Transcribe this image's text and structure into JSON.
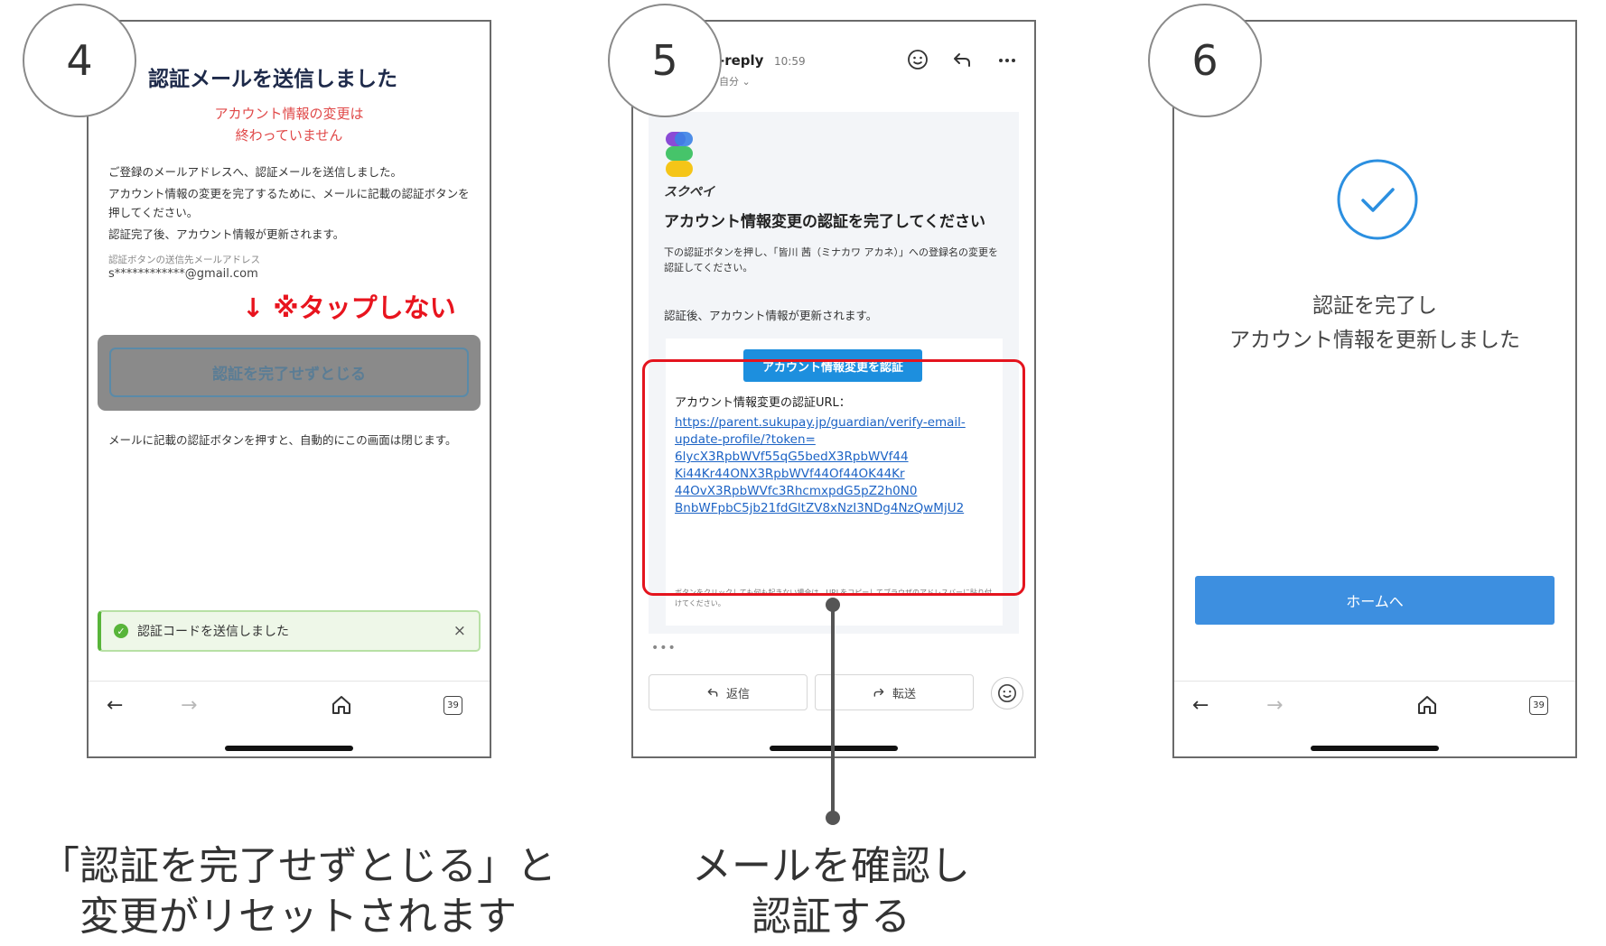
{
  "steps": {
    "s4": "4",
    "s5": "5",
    "s6": "6"
  },
  "screen4": {
    "title": "認証メールを送信しました",
    "warning_line1": "アカウント情報の変更は",
    "warning_line2": "終わっていません",
    "body_p1": "ご登録のメールアドレスへ、認証メールを送信しました。",
    "body_p2": "アカウント情報の変更を完了するために、メールに記載の認証ボタンを押してください。",
    "body_p3": "認証完了後、アカウント情報が更新されます。",
    "email_label": "認証ボタンの送信先メールアドレス",
    "email": "s************@gmail.com",
    "dont_tap": "↓ ※タップしない",
    "close_button": "認証を完了せずとじる",
    "note": "メールに記載の認証ボタンを押すと、自動的にこの画面は閉じます。",
    "toast_text": "認証コードを送信しました",
    "toast_close": "×",
    "tab_count": "39"
  },
  "screen5": {
    "sender": "-reply",
    "time": "10:59",
    "me": "自分 ⌄",
    "brand": "スクペイ",
    "heading": "アカウント情報変更の認証を完了してください",
    "description": "下の認証ボタンを押し、「皆川 茜（ミナカワ アカネ）」への登録名の変更を認証してください。",
    "after_text": "認証後、アカウント情報が更新されます。",
    "verify_button": "アカウント情報変更を認証",
    "url_label": "アカウント情報変更の認証URL：",
    "url_line1": "https://parent.sukupay.jp/guardian/verify-email-",
    "url_line2": "update-profile/?token=",
    "url_line3": "6lycX3RpbWVf55qG5bedX3RpbWVf44",
    "url_line4": "Ki44Kr44ONX3RpbWVf44Of44OK44Kr",
    "url_line5": "44OvX3RpbWVfc3RhcmxpdG5pZ2h0N0",
    "url_line6": "BnbWFpbC5jb21fdGltZV8xNzI3NDg4NzQwMjU2",
    "small_note": "ボタンをクリックしても何も起きない場合は、URLをコピーしてブラウザのアドレスバーに貼り付けてください。",
    "more": "•••",
    "reply": "返信",
    "forward": "転送"
  },
  "screen6": {
    "line1": "認証を完了し",
    "line2": "アカウント情報を更新しました",
    "home_button": "ホームへ",
    "tab_count": "39"
  },
  "captions": {
    "left_line1": "「認証を完了せずとじる」と",
    "left_line2": "変更がリセットされます",
    "mid_line1": "メールを確認し",
    "mid_line2": "認証する"
  },
  "colors": {
    "warning_red": "#e8141e",
    "link_blue": "#1c63c5",
    "button_blue": "#1d8fde",
    "home_blue": "#3d8fe0",
    "check_blue": "#2b8fe0",
    "toast_green": "#58b53a"
  },
  "icons": {
    "back": "left-arrow-icon",
    "forward": "right-arrow-icon",
    "home": "home-icon",
    "tabs": "tabs-icon",
    "emoji": "smiley-icon",
    "reply": "reply-arrow-icon",
    "more": "ellipsis-icon",
    "check": "check-circle-icon"
  }
}
